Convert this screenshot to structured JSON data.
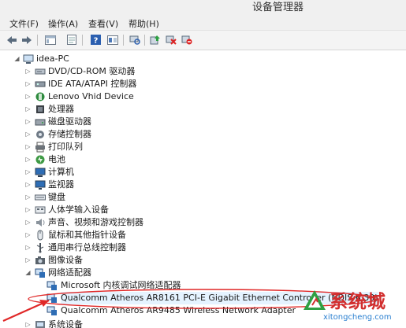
{
  "window": {
    "title": "设备管理器"
  },
  "menu": [
    "文件(F)",
    "操作(A)",
    "查看(V)",
    "帮助(H)"
  ],
  "toolbar": [
    "back-icon",
    "forward-icon",
    "show-hide-console-tree-icon",
    "properties-icon",
    "help-icon",
    "view-icon",
    "scan-hardware-icon",
    "update-driver-icon",
    "disable-device-icon",
    "uninstall-device-icon"
  ],
  "tree": {
    "root": "idea-PC",
    "categories": [
      {
        "label": "DVD/CD-ROM 驱动器",
        "icon": "dvd-drive-icon"
      },
      {
        "label": "IDE ATA/ATAPI 控制器",
        "icon": "ide-controller-icon"
      },
      {
        "label": "Lenovo Vhid Device",
        "icon": "lenovo-vhid-icon"
      },
      {
        "label": "处理器",
        "icon": "processor-icon"
      },
      {
        "label": "磁盘驱动器",
        "icon": "disk-drive-icon"
      },
      {
        "label": "存储控制器",
        "icon": "storage-controller-icon"
      },
      {
        "label": "打印队列",
        "icon": "printer-icon"
      },
      {
        "label": "电池",
        "icon": "battery-icon"
      },
      {
        "label": "计算机",
        "icon": "computer-icon"
      },
      {
        "label": "监视器",
        "icon": "monitor-icon"
      },
      {
        "label": "键盘",
        "icon": "keyboard-icon"
      },
      {
        "label": "人体学输入设备",
        "icon": "hid-icon"
      },
      {
        "label": "声音、视频和游戏控制器",
        "icon": "sound-icon"
      },
      {
        "label": "鼠标和其他指针设备",
        "icon": "mouse-icon"
      },
      {
        "label": "通用串行总线控制器",
        "icon": "usb-icon"
      },
      {
        "label": "图像设备",
        "icon": "imaging-device-icon"
      },
      {
        "label": "网络适配器",
        "icon": "network-adapter-icon"
      }
    ],
    "network_children": [
      "Microsoft 内核调试网络适配器",
      "Qualcomm Atheros AR8161 PCI-E Gigabit Ethernet Controller (NDIS 6.30)",
      "Qualcomm Atheros AR9485 Wireless Network Adapter"
    ],
    "last_category": "系统设备"
  },
  "watermark": {
    "name": "系统城",
    "url": "xitongcheng.com"
  }
}
